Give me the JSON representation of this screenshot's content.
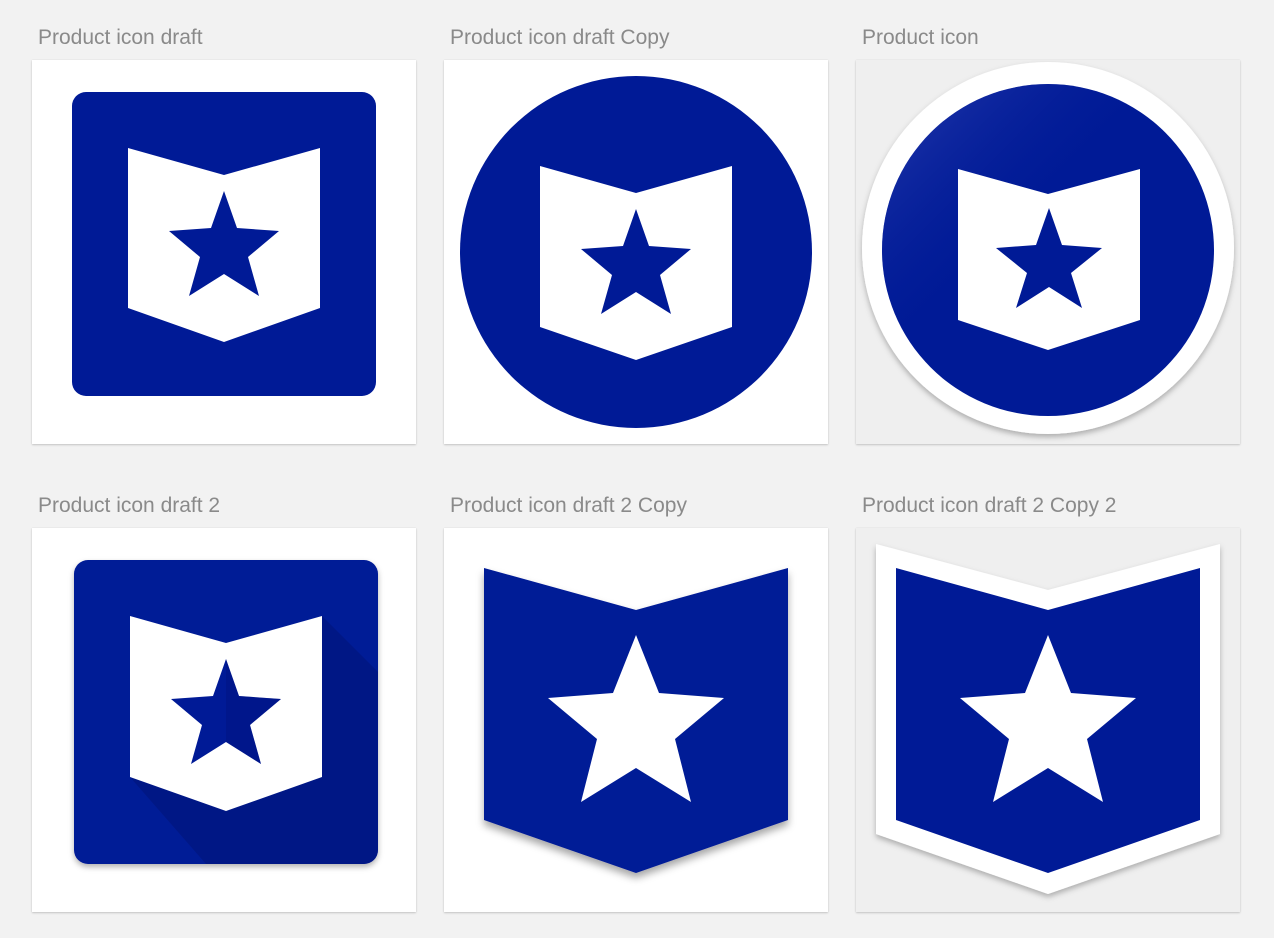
{
  "colors": {
    "canvas_background": "#f2f2f2",
    "artboard_white": "#ffffff",
    "artboard_gray": "#efefef",
    "icon_blue": "#001a96",
    "icon_white": "#ffffff",
    "label_gray": "#8a8a8a"
  },
  "artboards": [
    {
      "label": "Product icon draft",
      "icon": "square-badge-star-icon",
      "background": "white"
    },
    {
      "label": "Product icon draft Copy",
      "icon": "circle-badge-star-icon",
      "background": "white"
    },
    {
      "label": "Product icon",
      "icon": "circle-ring-badge-star-icon",
      "background": "gray"
    },
    {
      "label": "Product icon draft 2",
      "icon": "square-longshadow-badge-star-icon",
      "background": "white"
    },
    {
      "label": "Product icon draft 2 Copy",
      "icon": "blue-shield-star-icon",
      "background": "white"
    },
    {
      "label": "Product icon draft 2 Copy 2",
      "icon": "outlined-shield-star-icon",
      "background": "gray"
    }
  ]
}
